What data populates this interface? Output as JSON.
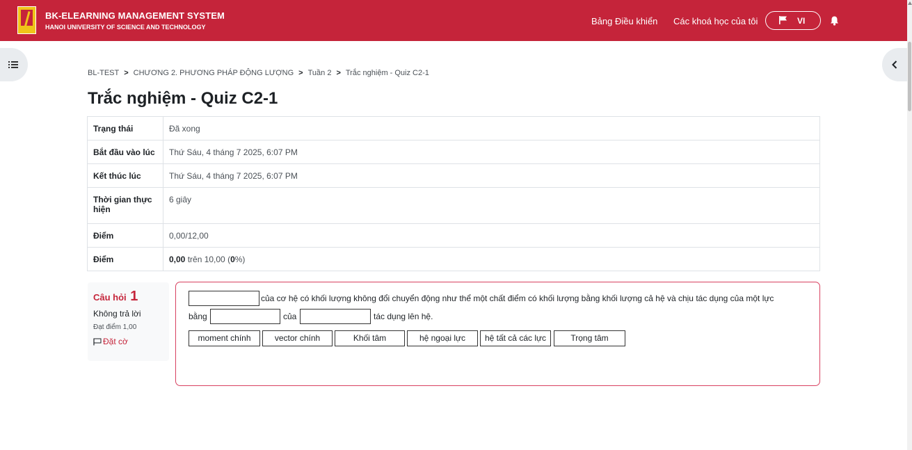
{
  "header": {
    "brand_title": "BK-ELEARNING MANAGEMENT SYSTEM",
    "brand_subtitle": "HANOI UNIVERSITY OF SCIENCE AND TECHNOLOGY",
    "nav_dashboard": "Bảng Điều khiển",
    "nav_my_courses": "Các khoá học của tôi",
    "language": "VI",
    "accent_color": "#c5243a"
  },
  "breadcrumb": {
    "items": [
      "BL-TEST",
      "CHƯƠNG 2. PHƯƠNG PHÁP ĐỘNG LƯỢNG",
      "Tuần 2",
      "Trắc nghiệm - Quiz C2-1"
    ],
    "separator": ">"
  },
  "page_title": "Trắc nghiệm - Quiz C2-1",
  "summary": {
    "rows": [
      {
        "label": "Trạng thái",
        "value": "Đã xong"
      },
      {
        "label": "Bắt đầu vào lúc",
        "value": "Thứ Sáu, 4 tháng 7 2025, 6:07 PM"
      },
      {
        "label": "Kết thúc lúc",
        "value": "Thứ Sáu, 4 tháng 7 2025, 6:07 PM"
      },
      {
        "label": "Thời gian thực hiện",
        "value": "6 giây"
      },
      {
        "label": "Điểm",
        "value": "0,00/12,00"
      },
      {
        "label": "Điểm",
        "grade_score": "0,00",
        "grade_mid": " trên 10,00 (",
        "grade_percent": "0",
        "grade_end": "%)"
      }
    ]
  },
  "question": {
    "label": "Câu hỏi",
    "number": "1",
    "state": "Không trả lời",
    "grade": "Đạt điểm 1,00",
    "flag_label": "Đặt cờ",
    "text_part1": "của cơ hệ có khối lượng không đổi chuyển động như thể một chất điểm có khối lượng bằng khối lượng cả hệ và chịu tác dụng của một lực",
    "text_part2": "bằng",
    "text_part3": "của",
    "text_part4": "tác dụng lên hệ.",
    "choices": [
      "moment chính",
      "vector chính",
      "Khối tâm",
      "hệ ngoại lực",
      "hệ tất cả các lực",
      "Trọng tâm"
    ]
  }
}
